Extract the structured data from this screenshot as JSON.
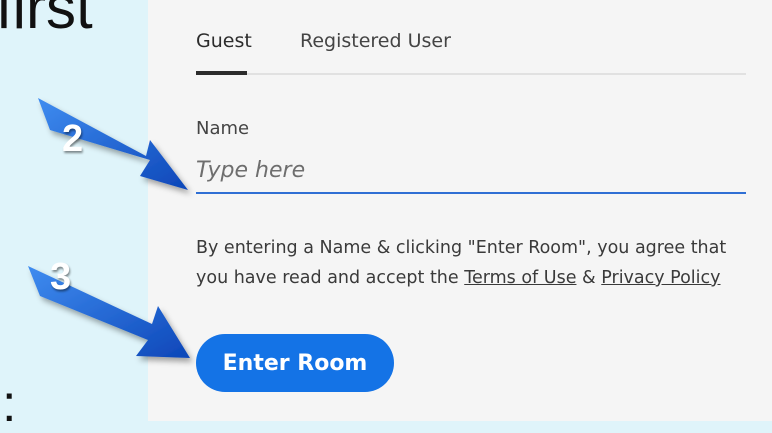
{
  "slide": {
    "top_text": "first",
    "bottom_text": ":"
  },
  "tabs": [
    {
      "label": "Guest",
      "active": true
    },
    {
      "label": "Registered User",
      "active": false
    }
  ],
  "form": {
    "name_label": "Name",
    "name_placeholder": "Type here",
    "agreement_text_before": "By entering a Name & clicking \"Enter Room\", you agree that you have read and accept the ",
    "terms_link": "Terms of Use",
    "agreement_and": " & ",
    "privacy_link": "Privacy Policy",
    "submit_label": "Enter Room"
  },
  "callouts": {
    "step_2": "2",
    "step_3": "3"
  },
  "colors": {
    "background": "#dff4fa",
    "panel": "#f5f5f5",
    "accent": "#1473e6",
    "input_underline": "#2f6fd4",
    "arrow": "#1a5fd0"
  }
}
